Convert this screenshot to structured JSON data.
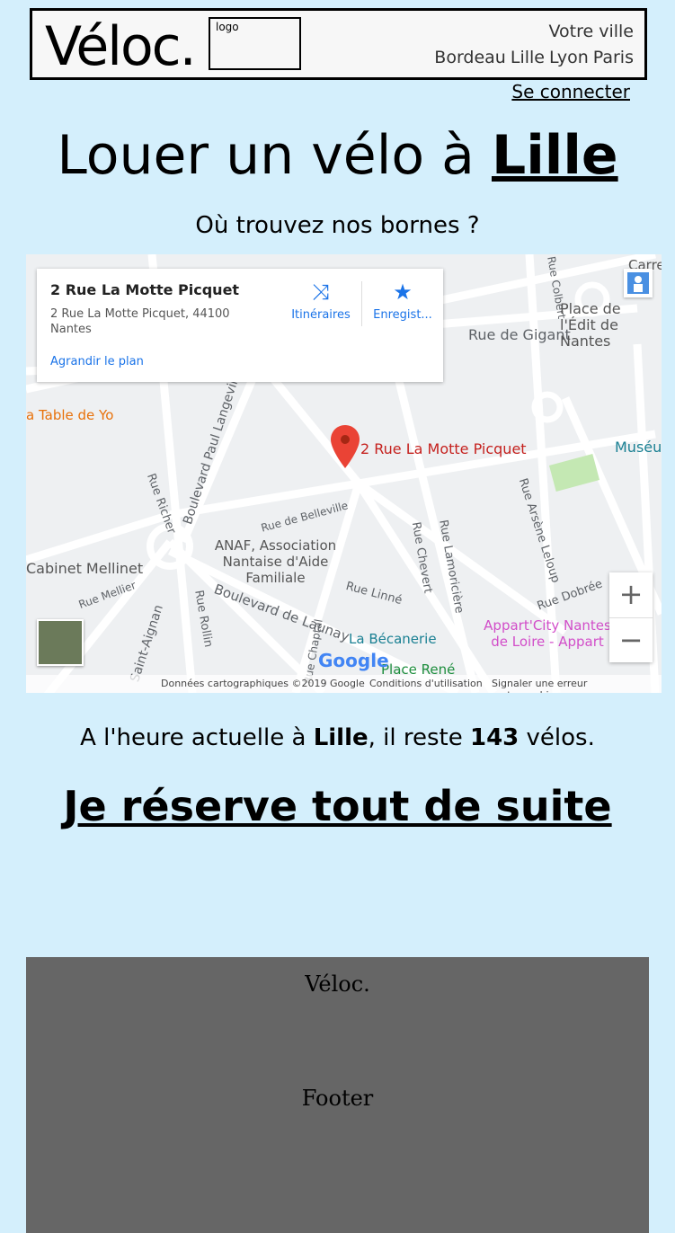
{
  "header": {
    "brand": "Véloc.",
    "logo_placeholder": "logo",
    "city_title": "Votre ville",
    "cities": [
      "Bordeau",
      "Lille",
      "Lyon",
      "Paris"
    ]
  },
  "login_link": "Se connecter",
  "headline": {
    "prefix": "Louer un vélo à ",
    "city": "Lille"
  },
  "subheading": "Où trouvez nos bornes ?",
  "map": {
    "card": {
      "title": "2 Rue La Motte Picquet",
      "address": "2 Rue La Motte Picquet, 44100 Nantes",
      "directions_label": "Itinéraires",
      "save_label": "Enregist...",
      "enlarge_label": "Agrandir le plan"
    },
    "marker_label": "2 Rue La Motte Picquet",
    "street_labels": [
      "Rue de Gigant",
      "Rue de Belleville",
      "Boulevard Paul Langevin",
      "Rue Richer",
      "Rue Chevert",
      "Rue Lamoricière",
      "Rue Arsène Leloup",
      "Rue Linné",
      "Boulevard de Launay",
      "Rue Mellier",
      "Rue Rollin",
      "Rue Dobrée",
      "Rue Colbert",
      "Rue Chaptal",
      "Saint-Aignan"
    ],
    "poi_labels": [
      "Place de l'Édit de Nantes",
      "a Table de Yo",
      "Muséu",
      "Cabinet Mellinet",
      "ANAF, Association Nantaise d'Aide Familiale",
      "La Bécanerie",
      "Appart'City Nantes de Loire - Appart",
      "Place René",
      "Carre"
    ],
    "zoom_in": "+",
    "zoom_out": "−",
    "google_logo": "Google",
    "attribution": [
      "Données cartographiques ©2019 Google",
      "Conditions d'utilisation",
      "Signaler une erreur cartographique"
    ]
  },
  "availability": {
    "p1": "A l'heure actuelle à ",
    "city": "Lille",
    "p2": ", il reste ",
    "count": "143",
    "p3": " vélos."
  },
  "cta": "Je réserve tout de suite",
  "footer": {
    "brand": "Véloc.",
    "text": "Footer"
  }
}
